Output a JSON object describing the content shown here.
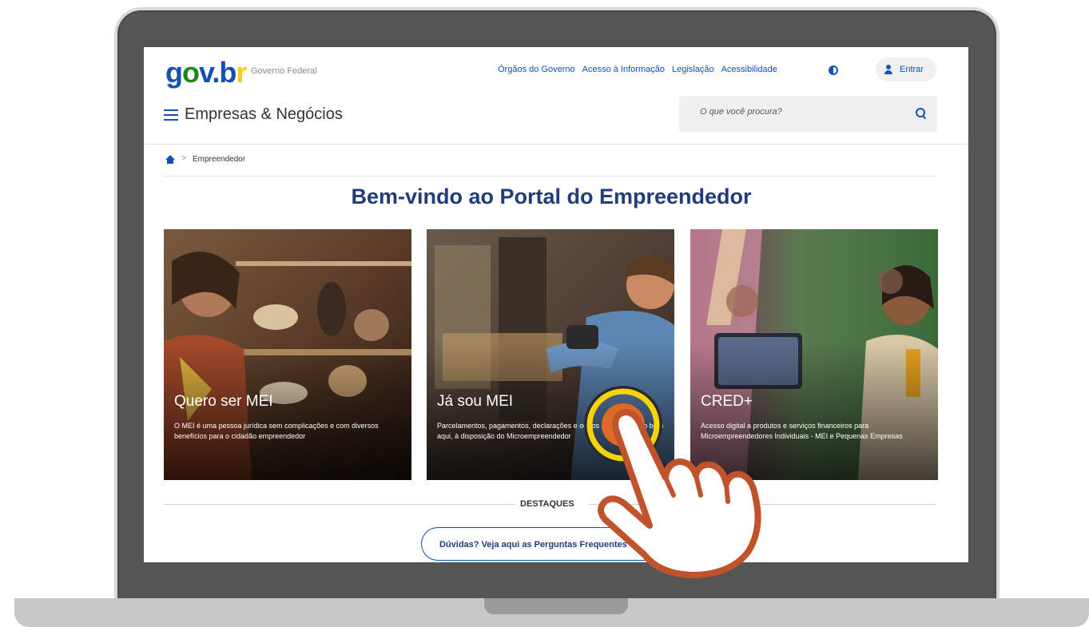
{
  "header": {
    "logo_text": "gov.br",
    "gov_label": "Governo Federal",
    "links": [
      "Órgãos do Governo",
      "Acesso à Informação",
      "Legislação",
      "Acessibilidade"
    ],
    "login_label": "Entrar",
    "site_title": "Empresas & Negócios",
    "search_placeholder": "O que você procura?"
  },
  "breadcrumb": {
    "current": "Empreendedor"
  },
  "page_title": "Bem-vindo ao Portal do Empreendedor",
  "cards": [
    {
      "title": "Quero ser MEI",
      "text": "O MEI é uma pessoa jurídica sem complicações e com diversos benefícios para o cidadão empreendedor"
    },
    {
      "title": "Já sou MEI",
      "text": "Parcelamentos, pagamentos, declarações e outros serviços estão bem aqui, à disposição do Microempreendedor"
    },
    {
      "title": "CRED+",
      "text": "Acesso digital a produtos e serviços financeiros para Microempreendedores Individuais - MEI e Pequenas Empresas"
    }
  ],
  "section_label": "DESTAQUES",
  "faq_button": "Dúvidas? Veja aqui as Perguntas Frequentes",
  "colors": {
    "primary": "#1351b4",
    "title": "#1f3d7a",
    "hand_stroke": "#c0532b",
    "highlight_ring": "#f4d40a",
    "touch_dot": "#dd6a26"
  }
}
